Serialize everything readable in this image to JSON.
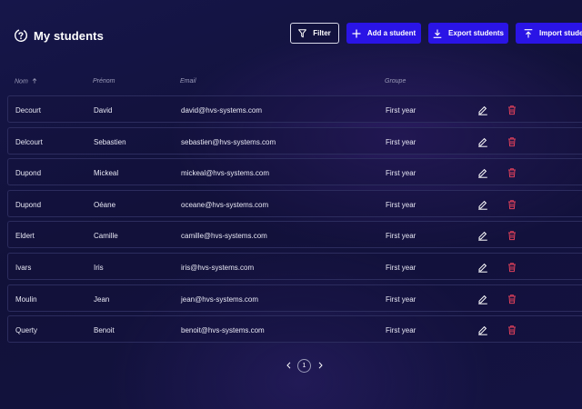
{
  "header": {
    "title": "My students",
    "title_icon": "help-circle-icon",
    "buttons": {
      "filter": "Filter",
      "add": "Add a student",
      "export": "Export students",
      "import": "Import students"
    }
  },
  "table": {
    "columns": {
      "nom": "Nom",
      "prenom": "Prénom",
      "email": "Email",
      "groupe": "Groupe"
    },
    "sort_icon": "arrow-up-icon",
    "rows": [
      {
        "nom": "Decourt",
        "prenom": "David",
        "email": "david@hvs-systems.com",
        "groupe": "First year"
      },
      {
        "nom": "Delcourt",
        "prenom": "Sebastien",
        "email": "sebastien@hvs-systems.com",
        "groupe": "First year"
      },
      {
        "nom": "Dupond",
        "prenom": "Mickeal",
        "email": "mickeal@hvs-systems.com",
        "groupe": "First year"
      },
      {
        "nom": "Dupond",
        "prenom": "Oéane",
        "email": "oceane@hvs-systems.com",
        "groupe": "First year"
      },
      {
        "nom": "Eldert",
        "prenom": "Camille",
        "email": "camille@hvs-systems.com",
        "groupe": "First year"
      },
      {
        "nom": "Ivars",
        "prenom": "Iris",
        "email": "iris@hvs-systems.com",
        "groupe": "First year"
      },
      {
        "nom": "Moulin",
        "prenom": "Jean",
        "email": "jean@hvs-systems.com",
        "groupe": "First year"
      },
      {
        "nom": "Querty",
        "prenom": "Benoit",
        "email": "benoit@hvs-systems.com",
        "groupe": "First year"
      }
    ]
  },
  "pagination": {
    "current_page": "1"
  },
  "colors": {
    "primary": "#2a14e6",
    "delete": "#e0405a",
    "background": "#121240"
  }
}
